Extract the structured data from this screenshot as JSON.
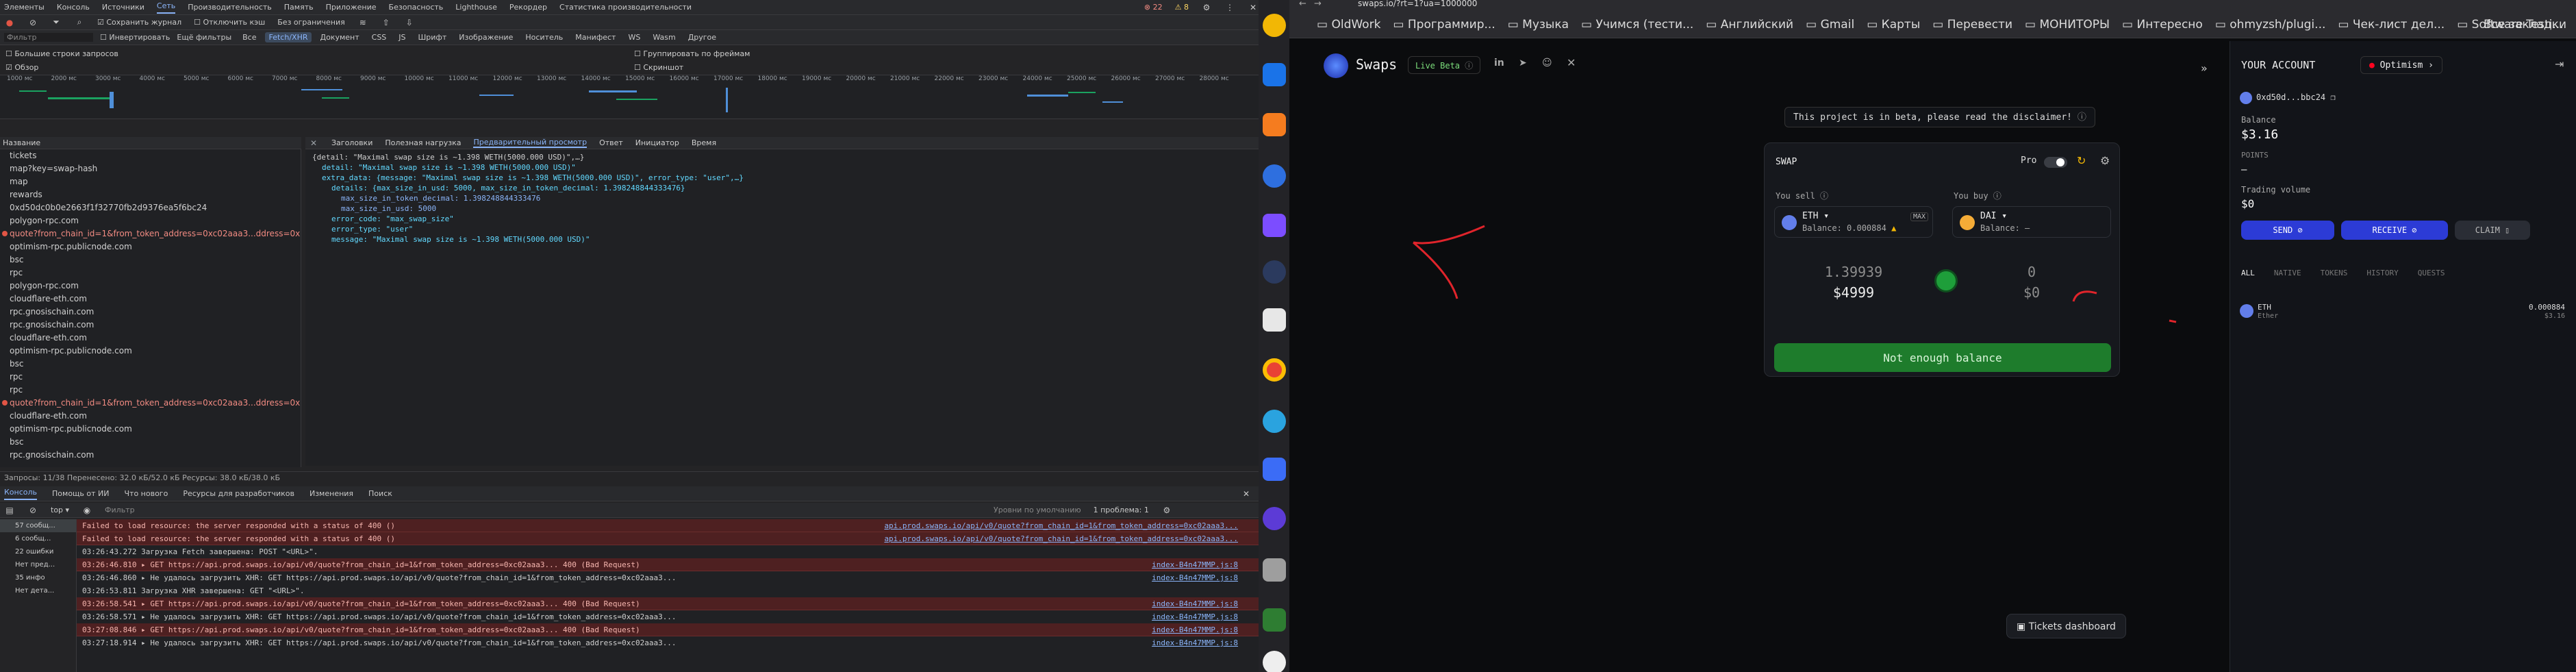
{
  "devtools": {
    "tabs": [
      "Элементы",
      "Консоль",
      "Источники",
      "Сеть",
      "Производительность",
      "Память",
      "Приложение",
      "Безопасность",
      "Lighthouse",
      "Рекордер",
      "Статистика производительности"
    ],
    "active_tab": "Сеть",
    "badges": {
      "errors": "22",
      "warnings": "8"
    },
    "toolbar": {
      "preserve_log": "Сохранить журнал",
      "disable_cache": "Отключить кэш",
      "throttle": "Без ограничения"
    },
    "filter": {
      "placeholder": "Фильтр",
      "invert": "Инвертировать",
      "hide_ext": "Ещё фильтры"
    },
    "type_chips": [
      "Все",
      "Fetch/XHR",
      "Документ",
      "CSS",
      "JS",
      "Шрифт",
      "Изображение",
      "Носитель",
      "Манифест",
      "WS",
      "Wasm",
      "Другое"
    ],
    "active_chip": "Fetch/XHR",
    "options": {
      "big_rows": "Большие строки запросов",
      "overview": "Обзор",
      "group_frames": "Группировать по фреймам",
      "screenshots": "Скриншот"
    },
    "timeline_ticks": [
      "1000 мс",
      "2000 мс",
      "3000 мс",
      "4000 мс",
      "5000 мс",
      "6000 мс",
      "7000 мс",
      "8000 мс",
      "9000 мс",
      "10000 мс",
      "11000 мс",
      "12000 мс",
      "13000 мс",
      "14000 мс",
      "15000 мс",
      "16000 мс",
      "17000 мс",
      "18000 мс",
      "19000 мс",
      "20000 мс",
      "21000 мс",
      "22000 мс",
      "23000 мс",
      "24000 мс",
      "25000 мс",
      "26000 мс",
      "27000 мс",
      "28000 мс"
    ],
    "list_header": "Название",
    "requests": [
      {
        "name": "tickets",
        "err": false
      },
      {
        "name": "map?key=swap-hash",
        "err": false
      },
      {
        "name": "map",
        "err": false
      },
      {
        "name": "rewards",
        "err": false
      },
      {
        "name": "0xd50dc0b0e2663f1f32770fb2d9376ea5f6bc24",
        "err": false
      },
      {
        "name": "polygon-rpc.com",
        "err": false
      },
      {
        "name": "quote?from_chain_id=1&from_token_address=0xc02aaa3...ddress=0x6b175474e8...",
        "err": true
      },
      {
        "name": "optimism-rpc.publicnode.com",
        "err": false
      },
      {
        "name": "bsc",
        "err": false
      },
      {
        "name": "rpc",
        "err": false
      },
      {
        "name": "polygon-rpc.com",
        "err": false
      },
      {
        "name": "cloudflare-eth.com",
        "err": false
      },
      {
        "name": "rpc.gnosischain.com",
        "err": false
      },
      {
        "name": "rpc.gnosischain.com",
        "err": false
      },
      {
        "name": "cloudflare-eth.com",
        "err": false
      },
      {
        "name": "optimism-rpc.publicnode.com",
        "err": false
      },
      {
        "name": "bsc",
        "err": false
      },
      {
        "name": "rpc",
        "err": false
      },
      {
        "name": "rpc",
        "err": false
      },
      {
        "name": "quote?from_chain_id=1&from_token_address=0xc02aaa3...ddress=0x6b175474e8...",
        "err": true
      },
      {
        "name": "cloudflare-eth.com",
        "err": false
      },
      {
        "name": "optimism-rpc.publicnode.com",
        "err": false
      },
      {
        "name": "bsc",
        "err": false
      },
      {
        "name": "rpc.gnosischain.com",
        "err": false
      }
    ],
    "detail_tabs": [
      "Заголовки",
      "Полезная нагрузка",
      "Предварительный просмотр",
      "Ответ",
      "Инициатор",
      "Время"
    ],
    "detail_active": "Предварительный просмотр",
    "preview": [
      "{detail: \"Maximal swap size is ~1.398 WETH(5000.000 USD)\",…}",
      "detail: \"Maximal swap size is ~1.398 WETH(5000.000 USD)\"",
      "extra_data: {message: \"Maximal swap size is ~1.398 WETH(5000.000 USD)\", error_type: \"user\",…}",
      "details: {max_size_in_usd: 5000, max_size_in_token_decimal: 1.398248844333476}",
      "max_size_in_token_decimal: 1.398248844333476",
      "max_size_in_usd: 5000",
      "error_code: \"max_swap_size\"",
      "error_type: \"user\"",
      "message: \"Maximal swap size is ~1.398 WETH(5000.000 USD)\""
    ],
    "status_bar": "Запросы: 11/38   Перенесено: 32.0 кБ/52.0 кБ   Ресурсы: 38.0 кБ/38.0 кБ",
    "drawer_tabs": [
      "Консоль",
      "Помощь от ИИ",
      "Что нового",
      "Ресурсы для разработчиков",
      "Изменения",
      "Поиск"
    ],
    "console_filter": "Фильтр",
    "console_levels": "Уровни по умолчанию",
    "problems": "1 проблема: 1",
    "console_side": [
      "57 сообщ...",
      "6 сообщ...",
      "22 ошибки",
      "Нет пред...",
      "35 инфо",
      "Нет дета..."
    ],
    "console_lines": [
      {
        "t": "Failed to load resource: the server responded with a status of 400 ()",
        "src": "api.prod.swaps.io/api/v0/quote?from_chain_id=1&from_token_address=0xc02aaa3...",
        "err": true
      },
      {
        "t": "Failed to load resource: the server responded with a status of 400 ()",
        "src": "api.prod.swaps.io/api/v0/quote?from_chain_id=1&from_token_address=0xc02aaa3...",
        "err": true
      },
      {
        "t": "03:26:43.272 Загрузка Fetch завершена: POST \"<URL>\".",
        "src": "",
        "err": false
      },
      {
        "t": "03:26:46.810 ▸ GET https://api.prod.swaps.io/api/v0/quote?from_chain_id=1&from_token_address=0xc02aaa3...  400 (Bad Request)",
        "src": "index-B4n47MMP.js:8",
        "err": true
      },
      {
        "t": "03:26:46.860 ▸ Не удалось загрузить XHR: GET https://api.prod.swaps.io/api/v0/quote?from_chain_id=1&from_token_address=0xc02aaa3...",
        "src": "index-B4n47MMP.js:8",
        "err": false
      },
      {
        "t": "03:26:53.811 Загрузка XHR завершена: GET \"<URL>\".",
        "src": "",
        "err": false
      },
      {
        "t": "03:26:58.541 ▸ GET https://api.prod.swaps.io/api/v0/quote?from_chain_id=1&from_token_address=0xc02aaa3...  400 (Bad Request)",
        "src": "index-B4n47MMP.js:8",
        "err": true
      },
      {
        "t": "03:26:58.571 ▸ Не удалось загрузить XHR: GET https://api.prod.swaps.io/api/v0/quote?from_chain_id=1&from_token_address=0xc02aaa3...",
        "src": "index-B4n47MMP.js:8",
        "err": false
      },
      {
        "t": "03:27:08.846 ▸ GET https://api.prod.swaps.io/api/v0/quote?from_chain_id=1&from_token_address=0xc02aaa3...  400 (Bad Request)",
        "src": "index-B4n47MMP.js:8",
        "err": true
      },
      {
        "t": "03:27:18.914 ▸ Не удалось загрузить XHR: GET https://api.prod.swaps.io/api/v0/quote?from_chain_id=1&from_token_address=0xc02aaa3...",
        "src": "index-B4n47MMP.js:8",
        "err": false
      }
    ]
  },
  "browser": {
    "url": "swaps.io/?rt=1?ua=1000000",
    "bookmarks": [
      "OldWork",
      "Программир...",
      "Музыка",
      "Учимся (тести...",
      "Английский",
      "Gmail",
      "Карты",
      "Перевести",
      "МОНИТОРЫ",
      "Интересно",
      "ohmyzsh/plugi...",
      "Чек-лист дел...",
      "Software-Testi..."
    ],
    "all_bookmarks": "Все закладки",
    "brand": "Swaps",
    "live_badge": "Live Beta",
    "beta_notice": "This project is in beta, please read the disclaimer!",
    "swap": {
      "title": "SWAP",
      "pro": "Pro",
      "you_sell": "You sell",
      "you_buy": "You buy",
      "sell_token": "ETH",
      "sell_balance": "Balance: 0.000884",
      "max": "MAX",
      "buy_token": "DAI",
      "buy_balance": "Balance: –",
      "sell_amount": "1.39939",
      "sell_usd": "$4999",
      "buy_amount": "0",
      "buy_usd": "$0",
      "cta": "Not enough balance"
    },
    "tickets": "Tickets dashboard",
    "account": {
      "title": "YOUR ACCOUNT",
      "network": "Optimism",
      "address": "0xd50d...bbc24",
      "balance_label": "Balance",
      "balance": "$3.16",
      "points_label": "POINTS",
      "points": "–",
      "volume_label": "Trading volume",
      "volume": "$0",
      "send": "SEND",
      "receive": "RECEIVE",
      "claim": "CLAIM",
      "tabs": [
        "ALL",
        "NATIVE",
        "TOKENS",
        "HISTORY",
        "QUESTS"
      ],
      "asset_symbol": "ETH",
      "asset_name": "Ether",
      "asset_amount": "0.000884",
      "asset_usd": "$3.16"
    }
  }
}
